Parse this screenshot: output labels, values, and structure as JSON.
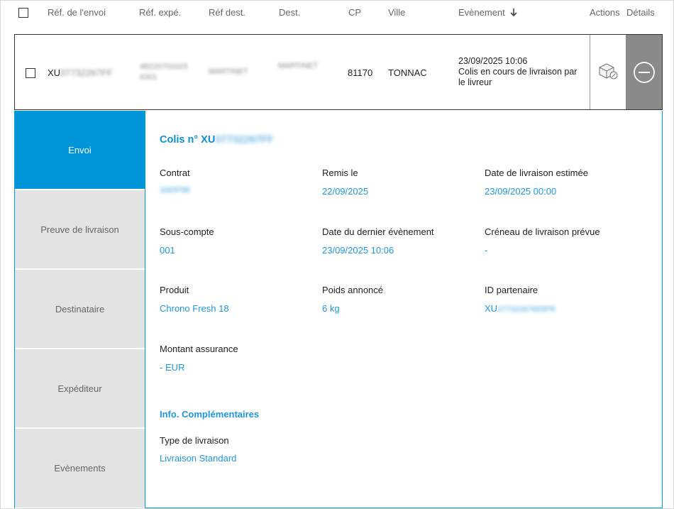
{
  "header": {
    "ref_envoi": "Réf. de l'envoi",
    "ref_expe": "Réf. expé.",
    "ref_dest": "Réf dest.",
    "dest": "Dest.",
    "cp": "CP",
    "ville": "Ville",
    "evenement": "Evènement",
    "actions": "Actions",
    "details": "Détails"
  },
  "row": {
    "ref_envoi": "XU07732267FF",
    "ref_expe_line1": "48220701023",
    "ref_expe_line2": "6301",
    "ref_dest": "MARTINET",
    "dest": "MARTINET",
    "cp": "81170",
    "ville": "TONNAC",
    "event_date": "23/09/2025 10:06",
    "event_line1": "Colis en cours de livraison par",
    "event_line2": "le livreur"
  },
  "tabs": [
    "Envoi",
    "Preuve de livraison",
    "Destinataire",
    "Expéditeur",
    "Evènements"
  ],
  "detail": {
    "title_prefix": "Colis n° XU",
    "title_blur": "07732267FF",
    "contrat_label": "Contrat",
    "contrat_value": "1023700",
    "remis_label": "Remis le",
    "remis_value": "22/09/2025",
    "livraison_estimee_label": "Date de livraison estimée",
    "livraison_estimee_value": "23/09/2025 00:00",
    "sous_compte_label": "Sous-compte",
    "sous_compte_value": "001",
    "dernier_evt_label": "Date du dernier évènement",
    "dernier_evt_value": "23/09/2025 10:06",
    "creneau_label": "Créneau de livraison prévue",
    "creneau_value": "-",
    "produit_label": "Produit",
    "produit_value": "Chrono Fresh 18",
    "poids_label": "Poids annoncé",
    "poids_value": "6 kg",
    "partenaire_label": "ID partenaire",
    "partenaire_prefix": "XU",
    "partenaire_blur": "07732267655FR",
    "assurance_label": "Montant assurance",
    "assurance_value": "- EUR",
    "info_title": "Info. Complémentaires",
    "type_label": "Type de livraison",
    "type_value": "Livraison Standard"
  },
  "colors": {
    "accent": "#0095d9",
    "link": "#1d96dc",
    "tab_inactive": "#e3e3e3",
    "details_bg": "#8a8a8a"
  }
}
